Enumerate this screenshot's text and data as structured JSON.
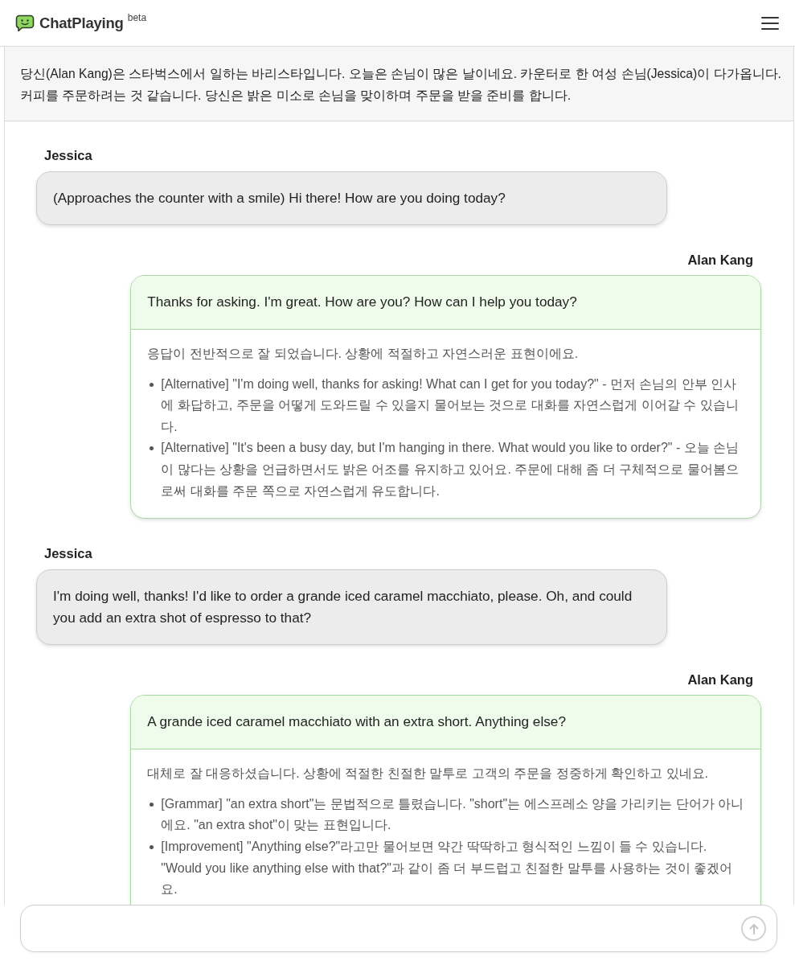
{
  "header": {
    "brand": "ChatPlaying",
    "badge": "beta"
  },
  "scenario": "당신(Alan Kang)은 스타벅스에서 일하는 바리스타입니다. 오늘은 손님이 많은 날이네요. 카운터로 한 여성 손님(Jessica)이 다가옵니다. 커피를 주문하려는 것 같습니다. 당신은 밝은 미소로 손님을 맞이하며 주문을 받을 준비를 합니다.",
  "messages": [
    {
      "kind": "partner",
      "speaker": "Jessica",
      "text": "(Approaches the counter with a smile) Hi there! How are you doing today?"
    },
    {
      "kind": "user",
      "speaker": "Alan Kang",
      "text": "Thanks for asking. I'm great. How are you? How can I help you today?",
      "feedback": {
        "summary": "응답이 전반적으로 잘 되었습니다. 상황에 적절하고 자연스러운 표현이에요.",
        "items": [
          "[Alternative] \"I'm doing well, thanks for asking! What can I get for you today?\" - 먼저 손님의 안부 인사에 화답하고, 주문을 어떻게 도와드릴 수 있을지 물어보는 것으로 대화를 자연스럽게 이어갈 수 있습니다.",
          "[Alternative] \"It's been a busy day, but I'm hanging in there. What would you like to order?\" - 오늘 손님이 많다는 상황을 언급하면서도 밝은 어조를 유지하고 있어요. 주문에 대해 좀 더 구체적으로 물어봄으로써 대화를 주문 쪽으로 자연스럽게 유도합니다."
        ]
      }
    },
    {
      "kind": "partner",
      "speaker": "Jessica",
      "text": "I'm doing well, thanks! I'd like to order a grande iced caramel macchiato, please. Oh, and could you add an extra shot of espresso to that?"
    },
    {
      "kind": "user",
      "speaker": "Alan Kang",
      "text": "A grande iced caramel macchiato with an extra short. Anything else?",
      "feedback": {
        "summary": "대체로 잘 대응하셨습니다. 상황에 적절한 친절한 말투로 고객의 주문을 정중하게 확인하고 있네요.",
        "items": [
          "[Grammar] \"an extra short\"는 문법적으로 틀렸습니다. \"short\"는 에스프레소 양을 가리키는 단어가 아니에요. \"an extra shot\"이 맞는 표현입니다.",
          "[Improvement] \"Anything else?\"라고만 물어보면 약간 딱딱하고 형식적인 느낌이 들 수 있습니다. \"Would you like anything else with that?\"과 같이 좀 더 부드럽고 친절한 말투를 사용하는 것이 좋겠어요."
        ]
      }
    }
  ],
  "composer": {
    "send_disabled": true
  }
}
